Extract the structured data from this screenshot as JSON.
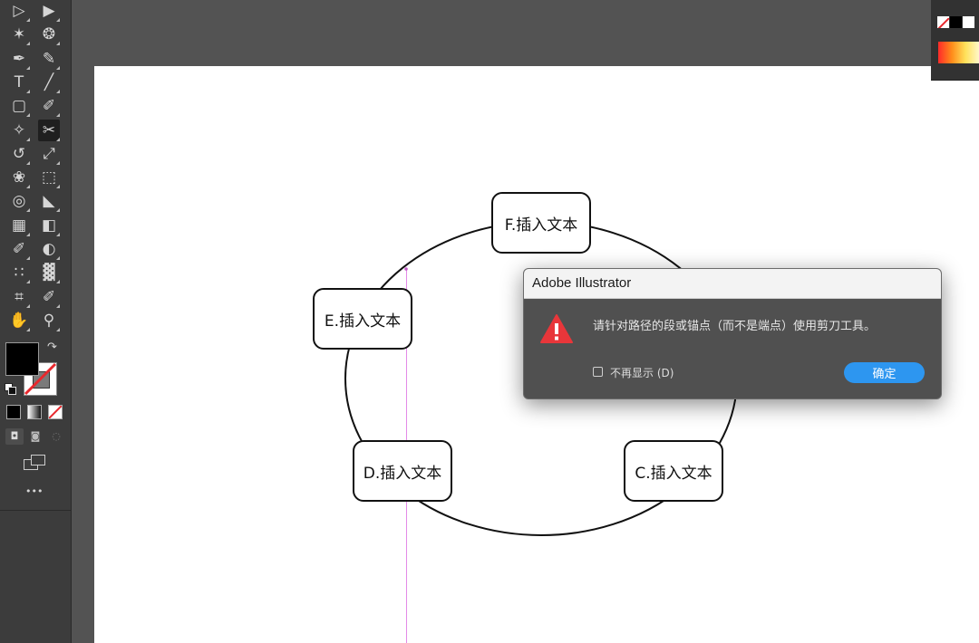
{
  "toolbar": {
    "tools": [
      {
        "name": "selection-tool",
        "glyph": "▷"
      },
      {
        "name": "direct-selection-tool",
        "glyph": "▶"
      },
      {
        "name": "magic-wand-tool",
        "glyph": "✶"
      },
      {
        "name": "lasso-tool",
        "glyph": "❂"
      },
      {
        "name": "pen-tool",
        "glyph": "✒"
      },
      {
        "name": "curvature-tool",
        "glyph": "✎"
      },
      {
        "name": "type-tool",
        "glyph": "T"
      },
      {
        "name": "line-segment-tool",
        "glyph": "╱"
      },
      {
        "name": "rectangle-tool",
        "glyph": "▢"
      },
      {
        "name": "paintbrush-tool",
        "glyph": "✐"
      },
      {
        "name": "shaper-tool",
        "glyph": "✧"
      },
      {
        "name": "scissors-tool",
        "glyph": "✂"
      },
      {
        "name": "rotate-tool",
        "glyph": "↺"
      },
      {
        "name": "scale-tool",
        "glyph": "⤢"
      },
      {
        "name": "warp-tool",
        "glyph": "❀"
      },
      {
        "name": "free-transform-tool",
        "glyph": "⬚"
      },
      {
        "name": "shape-builder-tool",
        "glyph": "◎"
      },
      {
        "name": "perspective-grid-tool",
        "glyph": "◣"
      },
      {
        "name": "mesh-tool",
        "glyph": "▦"
      },
      {
        "name": "gradient-tool",
        "glyph": "◧"
      },
      {
        "name": "eyedropper-tool",
        "glyph": "✐"
      },
      {
        "name": "blend-tool",
        "glyph": "◐"
      },
      {
        "name": "symbol-sprayer-tool",
        "glyph": "∷"
      },
      {
        "name": "column-graph-tool",
        "glyph": "▓"
      },
      {
        "name": "artboard-tool",
        "glyph": "⌗"
      },
      {
        "name": "slice-tool",
        "glyph": "✐"
      },
      {
        "name": "hand-tool",
        "glyph": "✋"
      },
      {
        "name": "zoom-tool",
        "glyph": "⚲"
      }
    ],
    "more_label": "•••"
  },
  "canvas": {
    "nodes": [
      {
        "id": "f",
        "label": "F.插入文本"
      },
      {
        "id": "e",
        "label": "E.插入文本"
      },
      {
        "id": "d",
        "label": "D.插入文本"
      },
      {
        "id": "c",
        "label": "C.插入文本"
      }
    ]
  },
  "dialog": {
    "title": "Adobe Illustrator",
    "message": "请针对路径的段或锚点（而不是端点）使用剪刀工具。",
    "dont_show_label": "不再显示 (D)",
    "ok_label": "确定",
    "ok_color": "#2d96f0",
    "warning_color": "#e8363a"
  },
  "colors": {
    "fill": "#000000",
    "stroke": "none",
    "guide": "#e38be8"
  }
}
